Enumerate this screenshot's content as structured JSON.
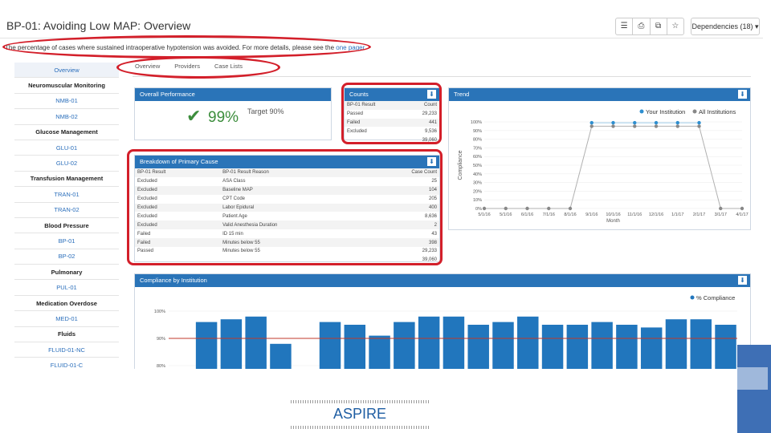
{
  "page": {
    "title": "BP-01: Avoiding Low MAP: Overview",
    "subtitle_prefix": "The percentage of cases where sustained intraoperative hypotension was avoided. For more details, please see the",
    "subtitle_link": "one pager",
    "subtitle_suffix": "."
  },
  "toolbar": {
    "icons": [
      "list-icon",
      "print-icon",
      "copy-icon",
      "star-icon"
    ],
    "icon_glyphs": [
      "☰",
      "⎙",
      "⧉",
      "☆"
    ],
    "dependencies_label": "Dependencies (18) ▾"
  },
  "sidebar": {
    "items": [
      {
        "label": "Overview",
        "kind": "active"
      },
      {
        "label": "Neuromuscular Monitoring",
        "kind": "header"
      },
      {
        "label": "NMB-01",
        "kind": "link"
      },
      {
        "label": "NMB-02",
        "kind": "link"
      },
      {
        "label": "Glucose Management",
        "kind": "header"
      },
      {
        "label": "GLU-01",
        "kind": "link"
      },
      {
        "label": "GLU-02",
        "kind": "link"
      },
      {
        "label": "Transfusion Management",
        "kind": "header"
      },
      {
        "label": "TRAN-01",
        "kind": "link"
      },
      {
        "label": "TRAN-02",
        "kind": "link"
      },
      {
        "label": "Blood Pressure",
        "kind": "header"
      },
      {
        "label": "BP-01",
        "kind": "link"
      },
      {
        "label": "BP-02",
        "kind": "link"
      },
      {
        "label": "Pulmonary",
        "kind": "header"
      },
      {
        "label": "PUL-01",
        "kind": "link"
      },
      {
        "label": "Medication Overdose",
        "kind": "header"
      },
      {
        "label": "MED-01",
        "kind": "link"
      },
      {
        "label": "Fluids",
        "kind": "header"
      },
      {
        "label": "FLUID-01-NC",
        "kind": "link"
      },
      {
        "label": "FLUID-01-C",
        "kind": "link"
      }
    ]
  },
  "tabs": [
    "Overview",
    "Providers",
    "Case Lists"
  ],
  "overall": {
    "title": "Overall Performance",
    "value": "99%",
    "target": "Target 90%"
  },
  "counts": {
    "title": "Counts",
    "headers": [
      "BP-01 Result",
      "Count"
    ],
    "rows": [
      [
        "Passed",
        "29,233"
      ],
      [
        "Failed",
        "441"
      ],
      [
        "Excluded",
        "9,536"
      ]
    ],
    "total": "39,060"
  },
  "breakdown": {
    "title": "Breakdown of Primary Cause",
    "headers": [
      "BP-01 Result",
      "BP-01 Result Reason",
      "Case Count"
    ],
    "rows": [
      [
        "Excluded",
        "ASA Class",
        "25"
      ],
      [
        "Excluded",
        "Baseline MAP",
        "104"
      ],
      [
        "Excluded",
        "CPT Code",
        "205"
      ],
      [
        "Excluded",
        "Labor Epidural",
        "400"
      ],
      [
        "Excluded",
        "Patient Age",
        "8,636"
      ],
      [
        "Excluded",
        "Valid Anesthesia Duration",
        "2"
      ],
      [
        "Failed",
        "ID 15 min",
        "43"
      ],
      [
        "Failed",
        "Minutes below 55",
        "398"
      ],
      [
        "Passed",
        "Minutes below 55",
        "29,233"
      ]
    ],
    "total": "39,060"
  },
  "trend": {
    "title": "Trend",
    "legend": [
      "Your Institution",
      "All Institutions"
    ],
    "colors": {
      "mine": "#2e8fd0",
      "all": "#888888"
    },
    "xlabel": "Month",
    "ylabel": "Compliance",
    "x_ticks": [
      "5/1/16",
      "5/1/16",
      "6/1/16",
      "7/1/16",
      "8/1/16",
      "9/1/16",
      "10/1/16",
      "11/1/16",
      "12/1/16",
      "1/1/17",
      "2/1/17",
      "3/1/17",
      "4/1/17"
    ],
    "y_ticks": [
      "100%",
      "90%",
      "80%",
      "70%",
      "60%",
      "50%",
      "40%",
      "30%",
      "20%",
      "10%",
      "0%"
    ]
  },
  "institution": {
    "title": "Compliance by Institution",
    "legend": "% Compliance",
    "y_ticks": [
      "100%",
      "90%",
      "80%",
      "70%"
    ],
    "bar_color": "#2176bd",
    "target_color": "#c0392b"
  },
  "chart_data": [
    {
      "type": "line",
      "title": "Trend",
      "xlabel": "Month",
      "ylabel": "Compliance",
      "x": [
        "5/1/16",
        "5/1/16",
        "6/1/16",
        "7/1/16",
        "8/1/16",
        "9/1/16",
        "10/1/16",
        "11/1/16",
        "12/1/16",
        "1/1/17",
        "2/1/17",
        "3/1/17",
        "4/1/17"
      ],
      "ylim": [
        0,
        100
      ],
      "series": [
        {
          "name": "Your Institution",
          "values": [
            null,
            null,
            null,
            null,
            null,
            99,
            99,
            99,
            99,
            99,
            99,
            null,
            null
          ]
        },
        {
          "name": "All Institutions",
          "values": [
            0,
            0,
            0,
            0,
            0,
            95,
            95,
            95,
            95,
            95,
            95,
            0,
            0
          ]
        }
      ]
    },
    {
      "type": "bar",
      "title": "Compliance by Institution",
      "series": [
        {
          "name": "% Compliance",
          "values": [
            73,
            96,
            97,
            98,
            88,
            null,
            96,
            95,
            91,
            96,
            98,
            98,
            95,
            96,
            98,
            95,
            95,
            96,
            95,
            94,
            97,
            97,
            95
          ]
        }
      ],
      "ylim": [
        70,
        100
      ],
      "target": 90
    }
  ],
  "footer": {
    "logo_text": "ASPIRE"
  }
}
